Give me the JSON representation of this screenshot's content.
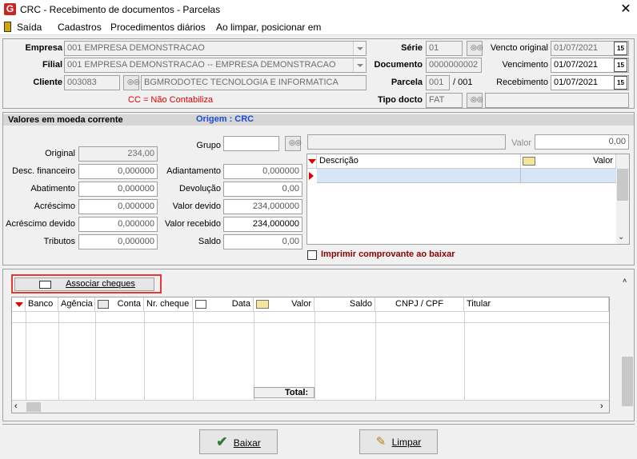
{
  "window": {
    "title": "CRC - Recebimento de documentos - Parcelas",
    "app_icon": "G",
    "close": "✕"
  },
  "menu": [
    "Saída",
    "Cadastros",
    "Procedimentos diários",
    "Ao limpar, posicionar em"
  ],
  "header": {
    "empresa_label": "Empresa",
    "empresa_value": "001 EMPRESA DEMONSTRACAO",
    "filial_label": "Filial",
    "filial_value": "001 EMPRESA DEMONSTRACAO -- EMPRESA DEMONSTRACAO",
    "cliente_label": "Cliente",
    "cliente_code": "003083",
    "cliente_name": "BGMRODOTEC TECNOLOGIA  E INFORMATICA",
    "cc_note": "CC = Não Contabiliza",
    "serie_label": "Série",
    "serie_value": "01",
    "documento_label": "Documento",
    "documento_value": "0000000002",
    "parcela_label": "Parcela",
    "parcela_value": "001",
    "parcela_total": "/ 001",
    "tipo_label": "Tipo docto",
    "tipo_value": "FAT",
    "vencto_original_label": "Vencto original",
    "vencto_original_value": "01/07/2021",
    "vencimento_label": "Vencimento",
    "vencimento_value": "01/07/2021",
    "recebimento_label": "Recebimento",
    "recebimento_value": "01/07/2021",
    "cal_glyph": "15"
  },
  "valores": {
    "section_title": "Valores em moeda corrente",
    "origem": "Origem : CRC",
    "original_label": "Original",
    "original_value": "234,00",
    "desc_fin_label": "Desc. financeiro",
    "desc_fin_value": "0,000000",
    "abatimento_label": "Abatimento",
    "abatimento_value": "0,000000",
    "acrescimo_label": "Acréscimo",
    "acrescimo_value": "0,000000",
    "acrescimo_devido_label": "Acréscimo devido",
    "acrescimo_devido_value": "0,000000",
    "tributos_label": "Tributos",
    "tributos_value": "0,000000",
    "grupo_label": "Grupo",
    "grupo_value": "",
    "adiantamento_label": "Adiantamento",
    "adiantamento_value": "0,000000",
    "devolucao_label": "Devolução",
    "devolucao_value": "0,00",
    "valor_devido_label": "Valor devido",
    "valor_devido_value": "234,000000",
    "valor_recebido_label": "Valor recebido",
    "valor_recebido_value": "234,000000",
    "saldo_label": "Saldo",
    "saldo_value": "0,00",
    "valor_label": "Valor",
    "valor_value": "0,00",
    "grid_cols": [
      "Descrição",
      "Valor"
    ],
    "imprimir_label": "Imprimir comprovante ao baixar"
  },
  "cheques": {
    "associar_label": "Associar cheques",
    "cols": [
      "Banco",
      "Agência",
      "Conta",
      "Nr. cheque",
      "Data",
      "Valor",
      "Saldo",
      "CNPJ / CPF",
      "Titular"
    ],
    "total_label": "Total:"
  },
  "footer": {
    "baixar_label": "Baixar",
    "limpar_label": "Limpar"
  }
}
